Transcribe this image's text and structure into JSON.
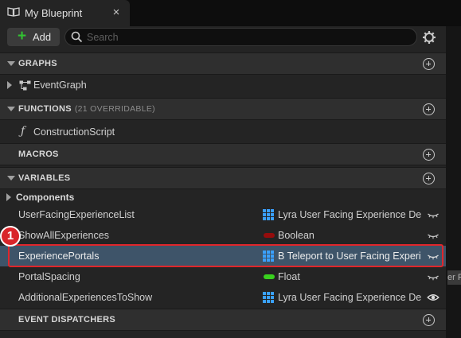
{
  "tab": {
    "title": "My Blueprint",
    "close_glyph": "×",
    "icon": "book-icon"
  },
  "toolbar": {
    "add_label": "Add",
    "search_placeholder": "Search",
    "settings_icon": "gear-icon"
  },
  "sections": {
    "graphs": {
      "title": "GRAPHS",
      "items": [
        {
          "label": "EventGraph",
          "icon": "event-graph-icon"
        }
      ]
    },
    "functions": {
      "title": "FUNCTIONS",
      "subtitle": "(21 OVERRIDABLE)",
      "items": [
        {
          "label": "ConstructionScript",
          "icon": "function-icon"
        }
      ]
    },
    "macros": {
      "title": "MACROS"
    },
    "variables": {
      "title": "VARIABLES",
      "category": "Components",
      "items": [
        {
          "name": "UserFacingExperienceList",
          "type": "Lyra User Facing Experience Definition",
          "type_icon": "grid",
          "color": "#3aa0ff",
          "eye": "closed"
        },
        {
          "name": "ShowAllExperiences",
          "type": "Boolean",
          "type_icon": "pill",
          "color": "#950c0c",
          "eye": "closed"
        },
        {
          "name": "ExperiencePortals",
          "type": "B Teleport to User Facing Experience",
          "type_icon": "grid",
          "color": "#3aa0ff",
          "eye": "closed",
          "selected": true
        },
        {
          "name": "PortalSpacing",
          "type": "Float",
          "type_icon": "pill",
          "color": "#39d11e",
          "eye": "closed"
        },
        {
          "name": "AdditionalExperiencesToShow",
          "type": "Lyra User Facing Experience Definition",
          "type_icon": "grid",
          "color": "#3aa0ff",
          "eye": "open"
        }
      ]
    },
    "event_dispatchers": {
      "title": "EVENT DISPATCHERS"
    }
  },
  "annotation": {
    "badge": "1",
    "color": "#e0262b"
  },
  "peek_text": "er F"
}
